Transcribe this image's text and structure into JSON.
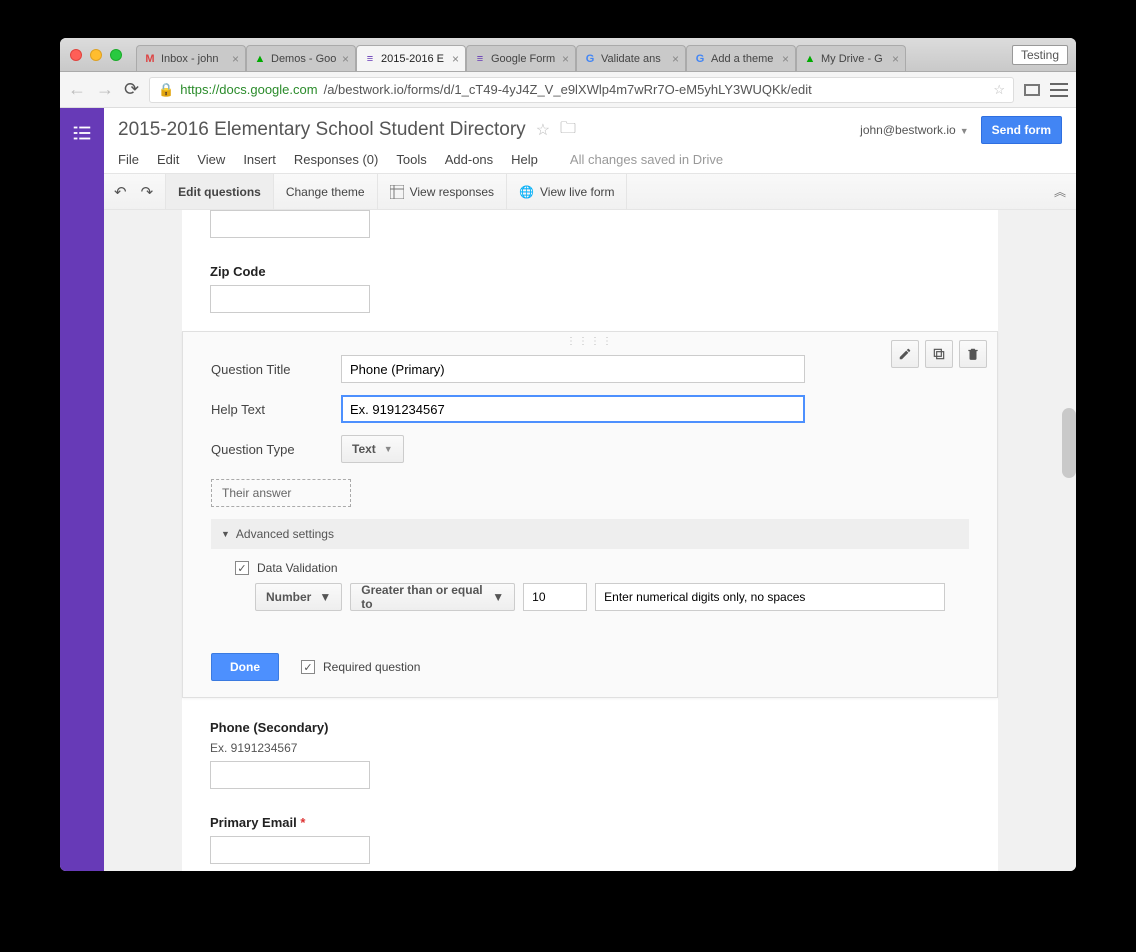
{
  "browser": {
    "testing_badge": "Testing",
    "url_host": "https://docs.google.com",
    "url_path": "/a/bestwork.io/forms/d/1_cT49-4yJ4Z_V_e9lXWlp4m7wRr7O-eM5yhLY3WUQKk/edit",
    "tabs": [
      {
        "label": "Inbox - john",
        "icon": "M",
        "icon_color": "#d44"
      },
      {
        "label": "Demos - Goo",
        "icon": "▲",
        "icon_color": "#0a0"
      },
      {
        "label": "2015-2016 E",
        "icon": "≡",
        "icon_color": "#673ab7",
        "active": true
      },
      {
        "label": "Google Form",
        "icon": "≡",
        "icon_color": "#673ab7"
      },
      {
        "label": "Validate ans",
        "icon": "G",
        "icon_color": "#4285f4"
      },
      {
        "label": "Add a theme",
        "icon": "G",
        "icon_color": "#4285f4"
      },
      {
        "label": "My Drive - G",
        "icon": "▲",
        "icon_color": "#0a0"
      }
    ]
  },
  "doc": {
    "title": "2015-2016 Elementary School Student Directory",
    "user": "john@bestwork.io",
    "send_btn": "Send form",
    "menu": [
      "File",
      "Edit",
      "View",
      "Insert",
      "Responses (0)",
      "Tools",
      "Add-ons",
      "Help"
    ],
    "saved": "All changes saved in Drive"
  },
  "toolbar": {
    "edit_questions": "Edit questions",
    "change_theme": "Change theme",
    "view_responses": "View responses",
    "view_live": "View live form"
  },
  "form": {
    "zip_label": "Zip Code",
    "phone2_label": "Phone (Secondary)",
    "phone2_help": "Ex. 9191234567",
    "email_label": "Primary Email",
    "email_required_mark": "*"
  },
  "editor": {
    "qtitle_label": "Question Title",
    "qtitle_value": "Phone (Primary)",
    "help_label": "Help Text",
    "help_value": "Ex. 9191234567",
    "qtype_label": "Question Type",
    "qtype_value": "Text",
    "their_answer": "Their answer",
    "adv_label": "Advanced settings",
    "dv_label": "Data Validation",
    "dv_type": "Number",
    "dv_op": "Greater than or equal to",
    "dv_value": "10",
    "dv_msg": "Enter numerical digits only, no spaces",
    "done": "Done",
    "required": "Required question"
  }
}
